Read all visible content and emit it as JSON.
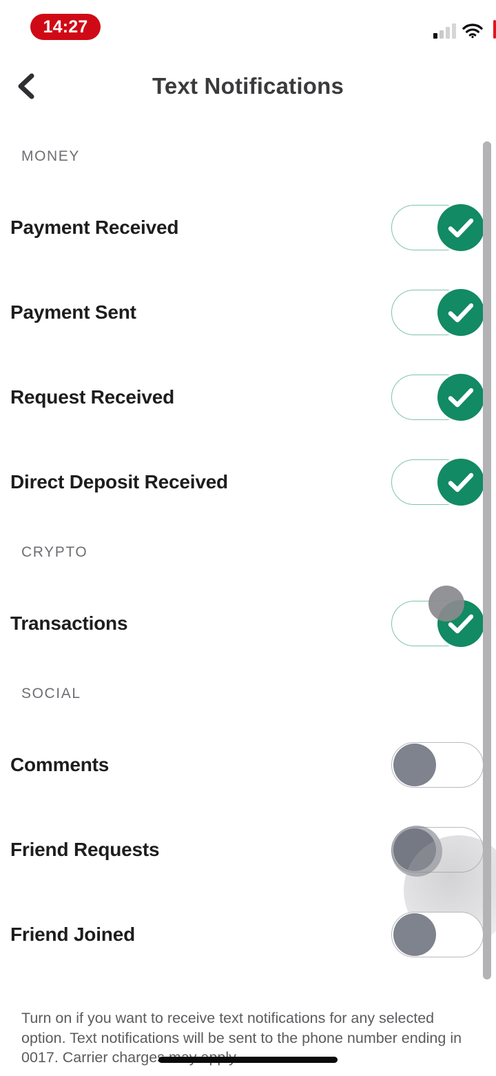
{
  "status_bar": {
    "time": "14:27",
    "time_pill_color": "#cf0a16",
    "icons": [
      "signal-bars-icon",
      "wifi-icon",
      "battery-icon"
    ],
    "signal_bars_filled": 1,
    "signal_bars_total": 4
  },
  "header": {
    "title": "Text Notifications",
    "back_icon": "chevron-left-icon"
  },
  "accent_colors": {
    "toggle_on": "#128a63",
    "toggle_on_border": "#7fc3ab",
    "toggle_off_knob": "#7e838e",
    "toggle_off_border": "#b9b9be",
    "scrollbar": "#b3b3b6"
  },
  "sections": [
    {
      "title": "MONEY",
      "rows": [
        {
          "label": "Payment Received",
          "state": "on",
          "state_label": "On"
        },
        {
          "label": "Payment Sent",
          "state": "on",
          "state_label": "On"
        },
        {
          "label": "Request Received",
          "state": "on",
          "state_label": "On"
        },
        {
          "label": "Direct Deposit Received",
          "state": "on",
          "state_label": "On"
        }
      ]
    },
    {
      "title": "CRYPTO",
      "rows": [
        {
          "label": "Transactions",
          "state": "on",
          "state_label": "On",
          "animating": true
        }
      ]
    },
    {
      "title": "SOCIAL",
      "rows": [
        {
          "label": "Comments",
          "state": "off",
          "state_label": "Off"
        },
        {
          "label": "Friend Requests",
          "state": "off",
          "state_label": "Off",
          "pressed": true
        },
        {
          "label": "Friend Joined",
          "state": "off",
          "state_label": "Off"
        }
      ]
    }
  ],
  "footer": {
    "text": "Turn on if you want to receive text notifications for any selected option. Text notifications will be sent to the phone number ending in 0017. Carrier charges may apply."
  }
}
